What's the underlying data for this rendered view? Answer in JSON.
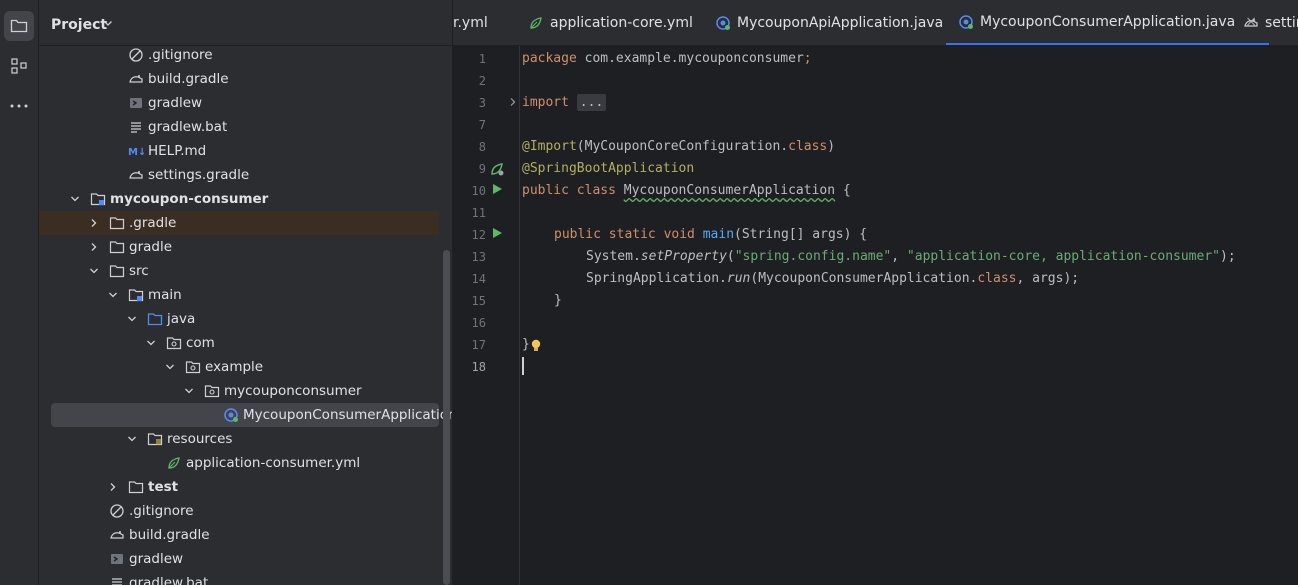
{
  "project_panel": {
    "title": "Project",
    "rows": [
      {
        "label": ".gitignore",
        "icon": "gitignore-icon",
        "depth": 3
      },
      {
        "label": "build.gradle",
        "icon": "gradle-icon",
        "depth": 3
      },
      {
        "label": "gradlew",
        "icon": "shell-script-icon",
        "depth": 3
      },
      {
        "label": "gradlew.bat",
        "icon": "text-file-icon",
        "depth": 3
      },
      {
        "label": "HELP.md",
        "icon": "markdown-icon",
        "depth": 3
      },
      {
        "label": "settings.gradle",
        "icon": "gradle-icon",
        "depth": 3
      },
      {
        "label": "mycoupon-consumer",
        "icon": "module-folder-icon",
        "depth": 1,
        "expanded": true,
        "bold": true
      },
      {
        "label": ".gradle",
        "icon": "folder-icon",
        "depth": 2,
        "expanded": false
      },
      {
        "label": "gradle",
        "icon": "folder-icon",
        "depth": 2,
        "expanded": false
      },
      {
        "label": "src",
        "icon": "folder-icon",
        "depth": 2,
        "expanded": true
      },
      {
        "label": "main",
        "icon": "source-root-folder-icon",
        "depth": 3,
        "expanded": true
      },
      {
        "label": "java",
        "icon": "java-source-folder-icon",
        "depth": 4,
        "expanded": true
      },
      {
        "label": "com",
        "icon": "package-icon",
        "depth": 5,
        "expanded": true
      },
      {
        "label": "example",
        "icon": "package-icon",
        "depth": 6,
        "expanded": true
      },
      {
        "label": "mycouponconsumer",
        "icon": "package-icon",
        "depth": 7,
        "expanded": true
      },
      {
        "label": "MycouponConsumerApplication",
        "icon": "spring-boot-class-icon",
        "depth": 8
      },
      {
        "label": "resources",
        "icon": "resources-folder-icon",
        "depth": 4,
        "expanded": true
      },
      {
        "label": "application-consumer.yml",
        "icon": "spring-yml-icon",
        "depth": 5
      },
      {
        "label": "test",
        "icon": "folder-icon",
        "depth": 3,
        "expanded": false,
        "bold": true
      },
      {
        "label": ".gitignore",
        "icon": "gitignore-icon",
        "depth": 2
      },
      {
        "label": "build.gradle",
        "icon": "gradle-icon",
        "depth": 2
      },
      {
        "label": "gradlew",
        "icon": "shell-script-icon",
        "depth": 2
      },
      {
        "label": "gradlew.bat",
        "icon": "text-file-icon",
        "depth": 2
      }
    ]
  },
  "tabs": [
    {
      "label": "r.yml",
      "icon": ""
    },
    {
      "label": "application-core.yml",
      "icon": "spring-yml-icon"
    },
    {
      "label": "MycouponApiApplication.java",
      "icon": "spring-boot-class-icon"
    },
    {
      "label": "MycouponConsumerApplication.java",
      "icon": "spring-boot-class-icon",
      "active": true
    },
    {
      "label": "settin",
      "icon": "gradle-icon"
    }
  ],
  "editor": {
    "line_numbers": [
      "1",
      "2",
      "3",
      "7",
      "8",
      "9",
      "10",
      "11",
      "12",
      "13",
      "14",
      "15",
      "16",
      "17",
      "18"
    ],
    "current_line": "18",
    "code": {
      "l1_kw": "package",
      "l1_rest": " com.example.mycouponconsumer",
      "l1_semi": ";",
      "l3_kw": "import",
      "l3_fold": "...",
      "l8_ann": "@Import",
      "l8_a": "(MyCouponCoreConfiguration.",
      "l8_kw": "class",
      "l8_b": ")",
      "l9_ann": "@SpringBootApplication",
      "l10_kw": "public class ",
      "l10_name": "MycouponConsumerApplication",
      "l10_rest": " {",
      "l12_kw": "public static void ",
      "l12_fn": "main",
      "l12_rest": "(String[] args) {",
      "l13_a": "System.",
      "l13_method": "setProperty",
      "l13_b": "(",
      "l13_str1": "\"spring.config.name\"",
      "l13_c": ", ",
      "l13_str2": "\"application-core, application-consumer\"",
      "l13_d": ");",
      "l14_a": "SpringApplication.",
      "l14_method": "run",
      "l14_b": "(MycouponConsumerApplication.",
      "l14_kw": "class",
      "l14_c": ", args);",
      "l15": "}",
      "l17": "}"
    }
  },
  "colors": {
    "accent": "#3574f0",
    "background": "#1e1f22",
    "panel": "#2b2d30"
  }
}
